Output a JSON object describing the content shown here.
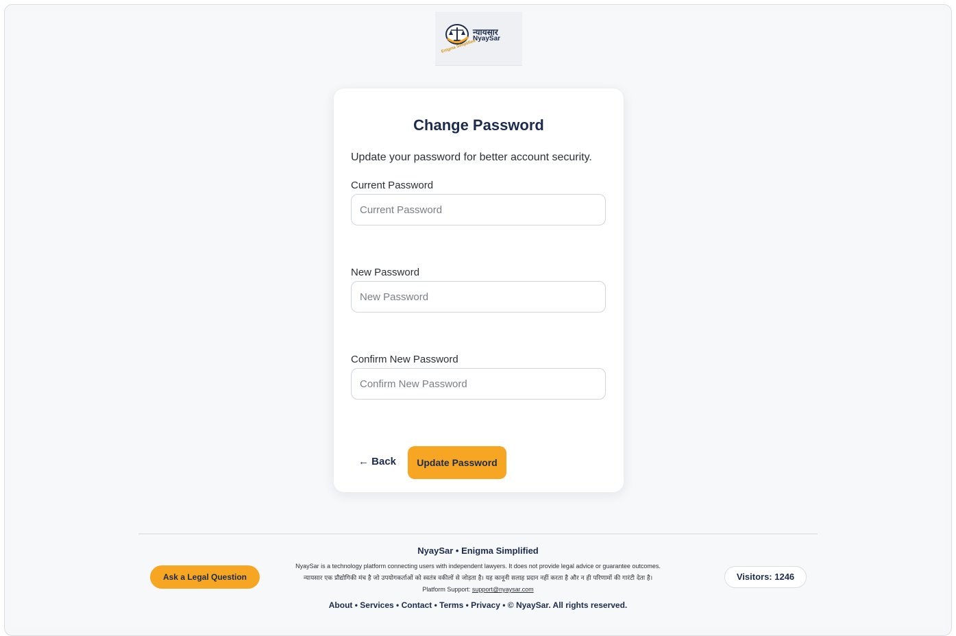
{
  "logo": {
    "hindi_name": "न्यायसार",
    "english_name": "NyaySar",
    "tagline": "Enigma Simplified"
  },
  "card": {
    "title": "Change Password",
    "subtitle": "Update your password for better account security.",
    "fields": [
      {
        "label": "Current Password",
        "placeholder": "Current Password",
        "value": ""
      },
      {
        "label": "New Password",
        "placeholder": "New Password",
        "value": ""
      },
      {
        "label": "Confirm New Password",
        "placeholder": "Confirm New Password",
        "value": ""
      }
    ],
    "back_label": "← Back",
    "submit_label": "Update Password"
  },
  "footer": {
    "title": "NyaySar • Enigma Simplified",
    "disclaimer_en": "NyaySar is a technology platform connecting users with independent lawyers. It does not provide legal advice or guarantee outcomes.",
    "disclaimer_hi": "न्यायसार एक प्रौद्योगिकी मंच है जो उपयोगकर्ताओं को स्वतंत्र वकीलों से जोड़ता है। यह कानूनी सलाह प्रदान नहीं करता है और न ही परिणामों की गारंटी देता है।",
    "support_prefix": "Platform Support:",
    "support_email": "support@nyaysar.com",
    "nav": {
      "about": "About",
      "services": "Services",
      "contact": "Contact",
      "terms": "Terms",
      "privacy": "Privacy",
      "copyright": "© NyaySar. All rights reserved.",
      "separator": "•"
    },
    "ask_button": "Ask a Legal Question",
    "visitors": "Visitors: 1246"
  },
  "colors": {
    "accent": "#f6a623",
    "navy": "#1b2b4d",
    "background": "#f7f8fa"
  }
}
